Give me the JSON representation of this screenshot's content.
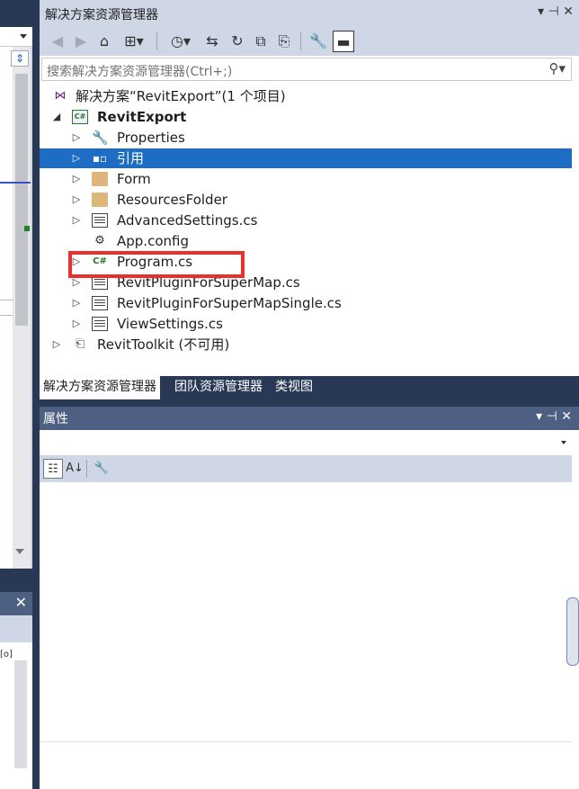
{
  "solution_explorer": {
    "title": "解决方案资源管理器",
    "title_controls": "▾ ⊣ ✕",
    "toolbar": [
      {
        "name": "back-icon",
        "glyph": "◀",
        "dim": true
      },
      {
        "name": "forward-icon",
        "glyph": "▶",
        "dim": true
      },
      {
        "name": "home-icon",
        "glyph": "⌂",
        "dim": false
      },
      {
        "name": "switch-views-icon",
        "glyph": "⊞▾",
        "dim": false
      },
      {
        "name": "pending-changes-icon",
        "glyph": "◷▾",
        "dim": false
      },
      {
        "name": "sync-icon",
        "glyph": "⇆",
        "dim": false
      },
      {
        "name": "refresh-icon",
        "glyph": "↻",
        "dim": false
      },
      {
        "name": "collapse-all-icon",
        "glyph": "⧉",
        "dim": false
      },
      {
        "name": "show-all-files-icon",
        "glyph": "⎘",
        "dim": false
      },
      {
        "name": "properties-wrench-icon",
        "glyph": "🔧",
        "dim": false
      },
      {
        "name": "preview-icon",
        "glyph": "▬",
        "dim": false
      }
    ],
    "search_placeholder": "搜索解决方案资源管理器(Ctrl+;)",
    "tree": [
      {
        "id": "solution",
        "label": "解决方案“RevitExport”(1 个项目)",
        "icon": "solution-icon",
        "icon_glyph": "⋈",
        "expander": "",
        "level": 0,
        "bold": false,
        "selected": false
      },
      {
        "id": "project",
        "label": "RevitExport",
        "icon": "csharp-project-icon",
        "icon_glyph": "C#",
        "expander": "◢",
        "level": 1,
        "bold": true,
        "selected": false
      },
      {
        "id": "properties",
        "label": "Properties",
        "icon": "wrench-icon",
        "icon_glyph": "🔧",
        "expander": "▷",
        "level": 2,
        "bold": false,
        "selected": false
      },
      {
        "id": "references",
        "label": "引用",
        "icon": "references-icon",
        "icon_glyph": "▪▫",
        "expander": "▷",
        "level": 2,
        "bold": false,
        "selected": true
      },
      {
        "id": "form",
        "label": "Form",
        "icon": "folder-icon",
        "icon_glyph": "",
        "expander": "▷",
        "level": 2,
        "bold": false,
        "selected": false
      },
      {
        "id": "resources",
        "label": "ResourcesFolder",
        "icon": "folder-icon",
        "icon_glyph": "",
        "expander": "▷",
        "level": 2,
        "bold": false,
        "selected": false
      },
      {
        "id": "advsettings",
        "label": "AdvancedSettings.cs",
        "icon": "form-file-icon",
        "icon_glyph": "",
        "expander": "▷",
        "level": 2,
        "bold": false,
        "selected": false
      },
      {
        "id": "appconfig",
        "label": "App.config",
        "icon": "config-file-icon",
        "icon_glyph": "⚙",
        "expander": "",
        "level": 2,
        "bold": false,
        "selected": false
      },
      {
        "id": "program",
        "label": "Program.cs",
        "icon": "csharp-file-icon",
        "icon_glyph": "C#",
        "expander": "▷",
        "level": 2,
        "bold": false,
        "selected": false
      },
      {
        "id": "rpsm",
        "label": "RevitPluginForSuperMap.cs",
        "icon": "form-file-icon",
        "icon_glyph": "",
        "expander": "▷",
        "level": 2,
        "bold": false,
        "selected": false
      },
      {
        "id": "rpsms",
        "label": "RevitPluginForSuperMapSingle.cs",
        "icon": "form-file-icon",
        "icon_glyph": "",
        "expander": "▷",
        "level": 2,
        "bold": false,
        "selected": false
      },
      {
        "id": "viewsettings",
        "label": "ViewSettings.cs",
        "icon": "form-file-icon",
        "icon_glyph": "",
        "expander": "▷",
        "level": 2,
        "bold": false,
        "selected": false
      },
      {
        "id": "toolkit",
        "label": "RevitToolkit (不可用)",
        "icon": "unavailable-project-icon",
        "icon_glyph": "⎗",
        "expander": "▷",
        "level": 1,
        "bold": false,
        "selected": false
      }
    ]
  },
  "bottom_tabs": [
    {
      "label": "解决方案资源管理器",
      "active": true
    },
    {
      "label": "团队资源管理器",
      "active": false
    },
    {
      "label": "类视图",
      "active": false
    }
  ],
  "properties": {
    "title": "属性",
    "title_controls": "▾ ⊣ ✕",
    "tools": [
      {
        "name": "categorized-icon",
        "glyph": "☷",
        "on": true
      },
      {
        "name": "alphabetical-icon",
        "glyph": "A↓",
        "on": false
      },
      {
        "name": "property-pages-icon",
        "glyph": "🔧",
        "on": false,
        "dim": true
      }
    ]
  },
  "left_panel": {
    "close_glyph": "✕",
    "split_glyph": "⇕",
    "fragment": "[o]"
  },
  "colors": {
    "selection": "#1c6dc3",
    "highlight_box": "#e8312f",
    "chrome": "#293955"
  }
}
